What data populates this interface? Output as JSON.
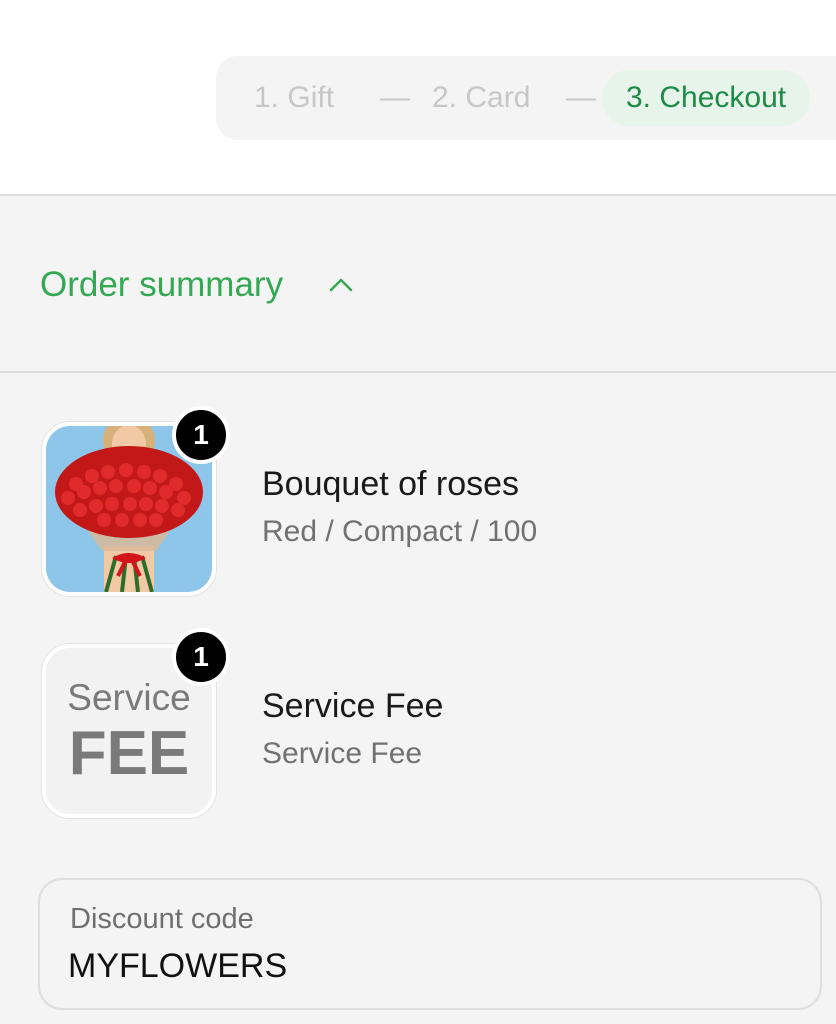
{
  "steps": {
    "gift": "1. Gift",
    "card": "2. Card",
    "checkout": "3. Checkout",
    "separator": "—"
  },
  "order_summary": {
    "title": "Order summary",
    "toggle_icon": "chevron-up-icon",
    "items": [
      {
        "name": "Bouquet of roses",
        "variant": "Red / Compact / 100",
        "quantity": "1",
        "image": "bouquet-of-roses"
      },
      {
        "name": "Service Fee",
        "variant": "Service Fee",
        "quantity": "1",
        "image_text_top": "Service",
        "image_text_bottom": "FEE"
      }
    ]
  },
  "discount": {
    "label": "Discount code",
    "value": "MYFLOWERS"
  },
  "colors": {
    "accent_green": "#34a853",
    "active_step_bg": "#e6f4ea",
    "active_step_text": "#1e8b47",
    "inactive_step_text": "#c7c7c7",
    "panel_bg": "#f4f4f4",
    "badge_bg": "#000000"
  }
}
